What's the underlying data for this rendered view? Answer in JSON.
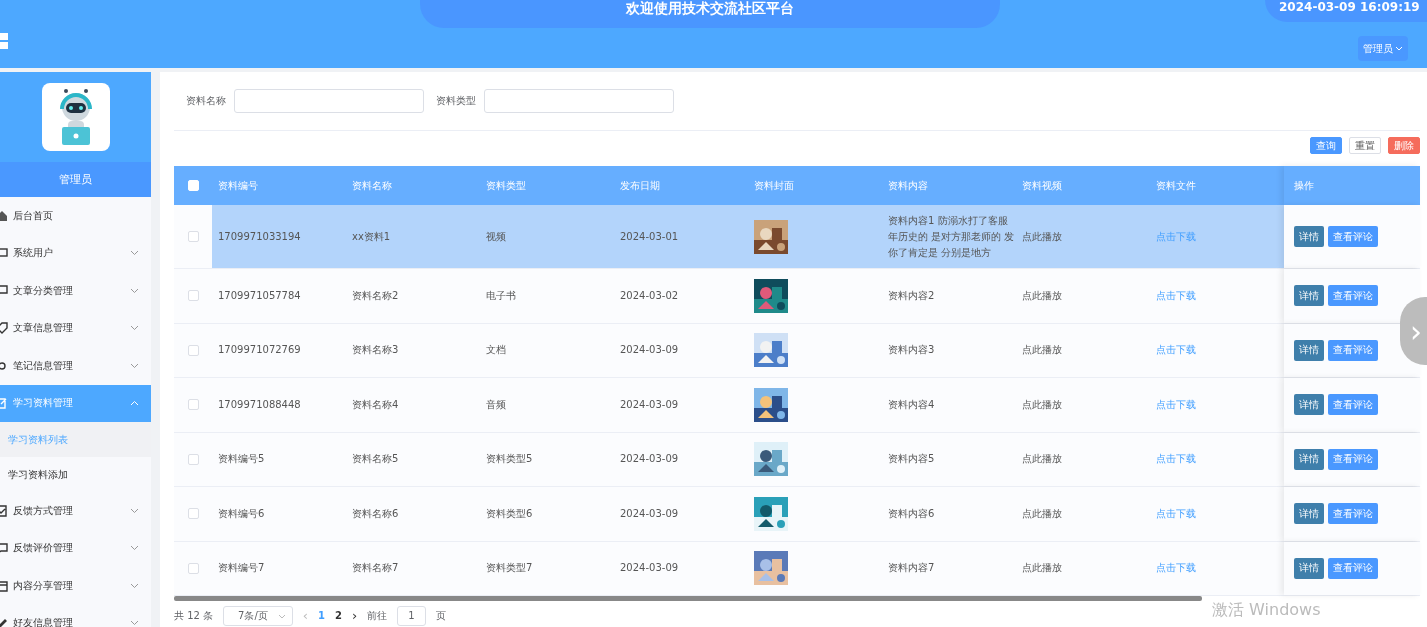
{
  "header": {
    "title": "欢迎使用技术交流社区平台",
    "datetime": "2024-03-09 16:09:19",
    "user_menu": "管理员"
  },
  "sidebar": {
    "role": "管理员",
    "items": [
      {
        "label": "后台首页",
        "selected": false
      },
      {
        "label": "系统用户",
        "expanded": false,
        "selected": false
      },
      {
        "label": "文章分类管理",
        "expanded": false,
        "selected": false
      },
      {
        "label": "文章信息管理",
        "expanded": false,
        "selected": false
      },
      {
        "label": "笔记信息管理",
        "expanded": false,
        "selected": false
      },
      {
        "label": "学习资料管理",
        "expanded": true,
        "selected": true,
        "children": [
          {
            "label": "学习资料列表",
            "selected": true
          },
          {
            "label": "学习资料添加",
            "selected": false
          }
        ]
      },
      {
        "label": "反馈方式管理",
        "expanded": false,
        "selected": false
      },
      {
        "label": "反馈评价管理",
        "expanded": false,
        "selected": false
      },
      {
        "label": "内容分享管理",
        "expanded": false,
        "selected": false
      },
      {
        "label": "好友信息管理",
        "expanded": false,
        "selected": false
      }
    ]
  },
  "search": {
    "fields": [
      {
        "label": "资料名称"
      },
      {
        "label": "资料类型"
      }
    ],
    "buttons": [
      {
        "label": "查询",
        "kind": "primary"
      },
      {
        "label": "重置",
        "kind": "plain"
      },
      {
        "label": "删除",
        "kind": "danger"
      }
    ]
  },
  "table": {
    "header_checked": false,
    "columns": [
      "资料编号",
      "资料名称",
      "资料类型",
      "发布日期",
      "资料封面",
      "资料内容",
      "资料视频",
      "资料文件",
      "操作"
    ],
    "rows": [
      {
        "selected": true,
        "checked": false,
        "id": "1709971033194",
        "name": "xx资料1",
        "type": "视频",
        "date": "2024-03-01",
        "content": "资料内容1 防溺水打了客服年历史的 是对方那老师的 发你了肯定是 分别是地方",
        "video": "点此播放",
        "file": "点击下载",
        "actions": [
          "详情",
          "查看评论"
        ]
      },
      {
        "selected": false,
        "checked": false,
        "id": "1709971057784",
        "name": "资料名称2",
        "type": "电子书",
        "date": "2024-03-02",
        "content": "资料内容2",
        "video": "点此播放",
        "file": "点击下载",
        "actions": [
          "详情",
          "查看评论"
        ]
      },
      {
        "selected": false,
        "checked": false,
        "id": "1709971072769",
        "name": "资料名称3",
        "type": "文档",
        "date": "2024-03-09",
        "content": "资料内容3",
        "video": "点此播放",
        "file": "点击下载",
        "actions": [
          "详情",
          "查看评论"
        ]
      },
      {
        "selected": false,
        "checked": false,
        "id": "1709971088448",
        "name": "资料名称4",
        "type": "音频",
        "date": "2024-03-09",
        "content": "资料内容4",
        "video": "点此播放",
        "file": "点击下载",
        "actions": [
          "详情",
          "查看评论"
        ]
      },
      {
        "selected": false,
        "checked": false,
        "id": "资料编号5",
        "name": "资料名称5",
        "type": "资料类型5",
        "date": "2024-03-09",
        "content": "资料内容5",
        "video": "点此播放",
        "file": "点击下载",
        "actions": [
          "详情",
          "查看评论"
        ]
      },
      {
        "selected": false,
        "checked": false,
        "id": "资料编号6",
        "name": "资料名称6",
        "type": "资料类型6",
        "date": "2024-03-09",
        "content": "资料内容6",
        "video": "点此播放",
        "file": "点击下载",
        "actions": [
          "详情",
          "查看评论"
        ]
      },
      {
        "selected": false,
        "checked": false,
        "id": "资料编号7",
        "name": "资料名称7",
        "type": "资料类型7",
        "date": "2024-03-09",
        "content": "资料内容7",
        "video": "点此播放",
        "file": "点击下载",
        "actions": [
          "详情",
          "查看评论"
        ]
      }
    ]
  },
  "pagination": {
    "total": "共 12 条",
    "page_size": "7条/页",
    "prev": "‹",
    "next": "›",
    "pages": [
      {
        "label": "1",
        "selected": true
      },
      {
        "label": "2",
        "selected": false
      }
    ],
    "goto_label": "前往",
    "goto_value": "1",
    "goto_suffix": "页"
  },
  "next_handle": "›",
  "watermark_os": "激活 Windows"
}
